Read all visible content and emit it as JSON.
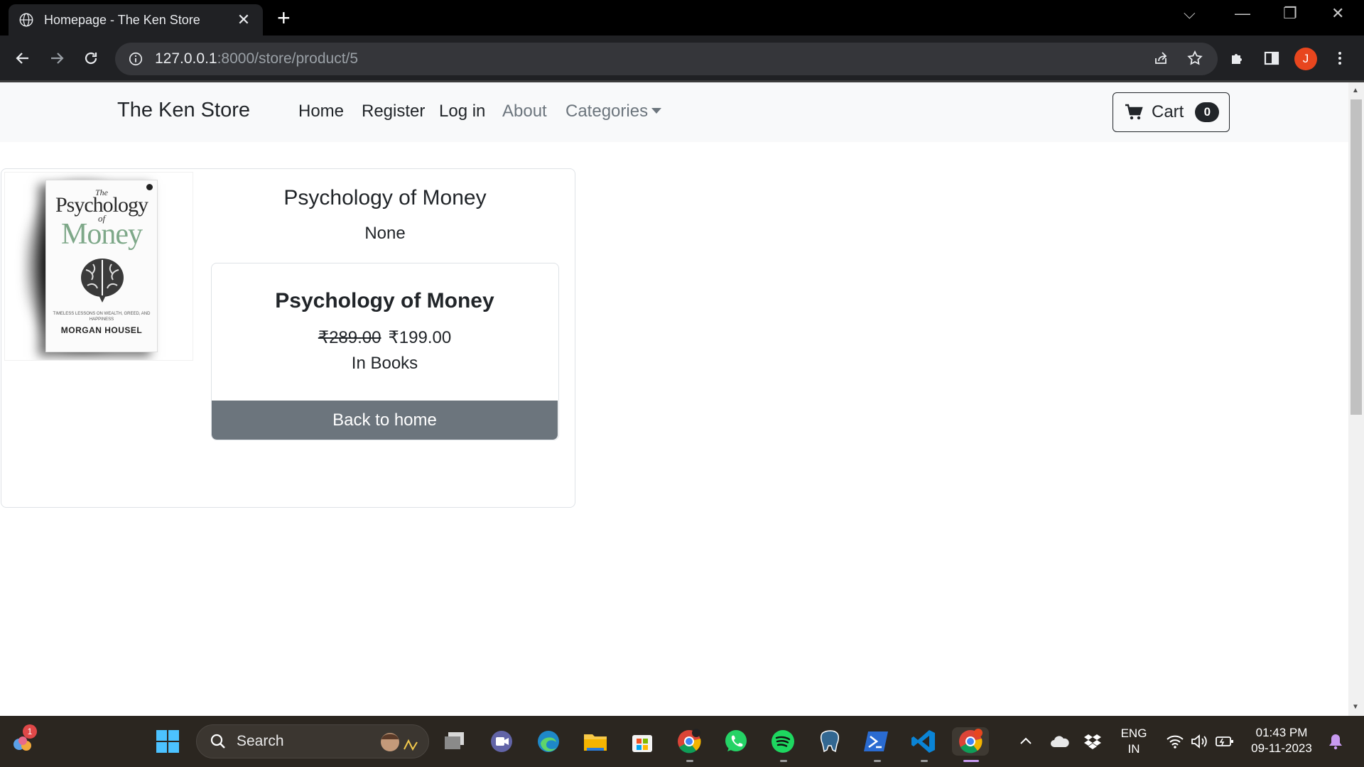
{
  "browser": {
    "tab_title": "Homepage - The Ken Store",
    "url_host": "127.0.0.1",
    "url_rest": ":8000/store/product/5",
    "profile_initial": "J"
  },
  "navbar": {
    "brand": "The Ken Store",
    "links": [
      "Home",
      "Register",
      "Log in",
      "About",
      "Categories"
    ],
    "cart_label": "Cart",
    "cart_count": "0"
  },
  "product": {
    "title": "Psychology of Money",
    "description": "None",
    "inner_title": "Psychology of Money",
    "old_price": "₹289.00",
    "price": "₹199.00",
    "category": "In Books",
    "back_label": "Back to home",
    "cover": {
      "the": "The",
      "psychology": "Psychology",
      "of": "of",
      "money": "Money",
      "subtitle": "TIMELESS LESSONS ON WEALTH, GREED, AND HAPPINESS",
      "author": "MORGAN HOUSEL"
    }
  },
  "taskbar": {
    "search_label": "Search",
    "widget_badge": "1",
    "lang_top": "ENG",
    "lang_bottom": "IN",
    "time": "01:43 PM",
    "date": "09-11-2023"
  },
  "colors": {
    "accent_secondary": "#6c757d",
    "navbar_bg": "#f8f9fa",
    "profile": "#e8461e"
  }
}
